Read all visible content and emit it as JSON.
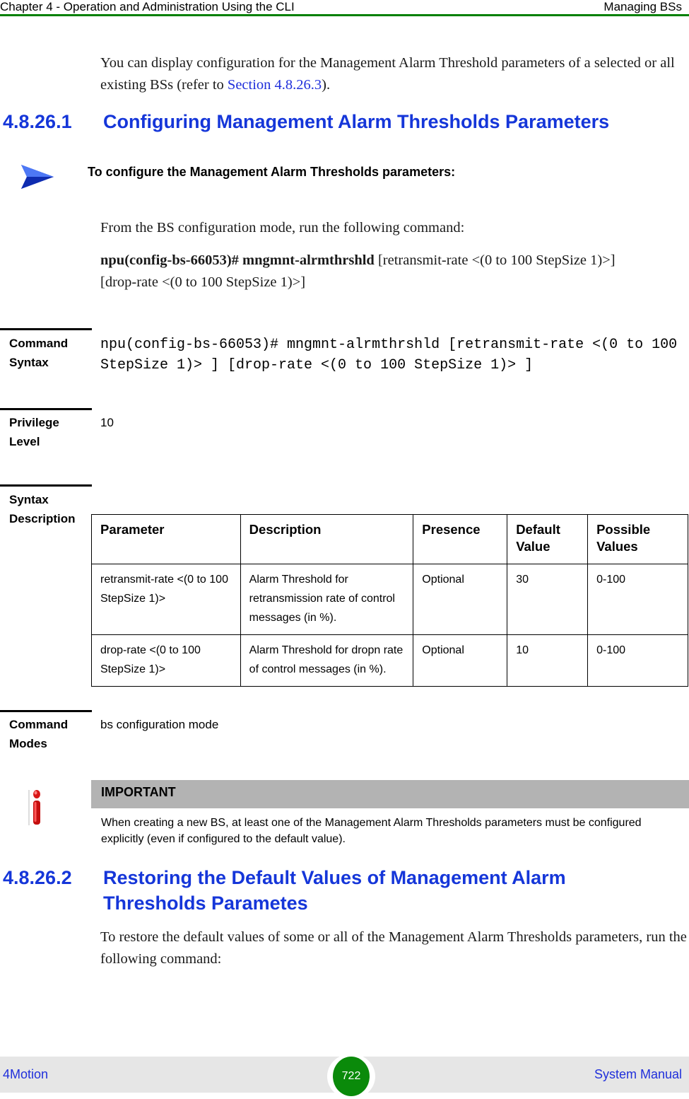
{
  "header": {
    "chapter": "Chapter 4 - Operation and Administration Using the CLI",
    "section": "Managing BSs",
    "accent_color": "#008000"
  },
  "intro": {
    "text_before_link": "You can display configuration for the Management Alarm Threshold parameters of a selected or all existing BSs (refer to ",
    "link": "Section 4.8.26.3",
    "text_after_link": ")."
  },
  "section1": {
    "number": "4.8.26.1",
    "title": "Configuring Management Alarm Thresholds Parameters",
    "procedure_icon": "arrow-right-icon",
    "procedure_title": "To configure the Management Alarm Thresholds parameters:",
    "run_text": "From the BS configuration mode, run the following command:",
    "command_bold": "npu(config-bs-66053)# mngmnt-alrmthrshld",
    "command_rest": " [retransmit-rate <(0 to 100 StepSize 1)>] [drop-rate <(0 to 100 StepSize 1)>]"
  },
  "command_syntax": {
    "label_line1": "Command",
    "label_line2": "Syntax",
    "value": "npu(config-bs-66053)# mngmnt-alrmthrshld [retransmit-rate <(0 to 100 StepSize 1)> ] [drop-rate <(0 to 100 StepSize 1)> ]"
  },
  "privilege_level": {
    "label_line1": "Privilege",
    "label_line2": "Level",
    "value": "10"
  },
  "syntax_description": {
    "label_line1": "Syntax",
    "label_line2": "Description",
    "columns": [
      "Parameter",
      "Description",
      "Presence",
      "Default Value",
      "Possible Values"
    ],
    "rows": [
      {
        "parameter": "retransmit-rate <(0 to 100 StepSize 1)>",
        "description": "Alarm Threshold for retransmission rate of control messages (in %).",
        "presence": "Optional",
        "default": "30",
        "possible": "0-100"
      },
      {
        "parameter": "drop-rate <(0 to 100 StepSize 1)>",
        "description": "Alarm Threshold for dropn rate of control messages (in %).",
        "presence": "Optional",
        "default": "10",
        "possible": "0-100"
      }
    ]
  },
  "command_modes": {
    "label_line1": "Command",
    "label_line2": "Modes",
    "value": "bs configuration mode"
  },
  "important": {
    "icon": "info-icon",
    "title": "IMPORTANT",
    "text": "When creating a new BS, at least one of the Management Alarm Thresholds parameters must be configured explicitly (even if configured to the default value)."
  },
  "section2": {
    "number": "4.8.26.2",
    "title_line1": "Restoring the Default Values of Management Alarm",
    "title_line2": "Thresholds Parametes",
    "text": "To restore the default values of some or all of the Management Alarm Thresholds parameters, run the following command:"
  },
  "footer": {
    "product": "4Motion",
    "page_number": "722",
    "manual": "System Manual"
  }
}
